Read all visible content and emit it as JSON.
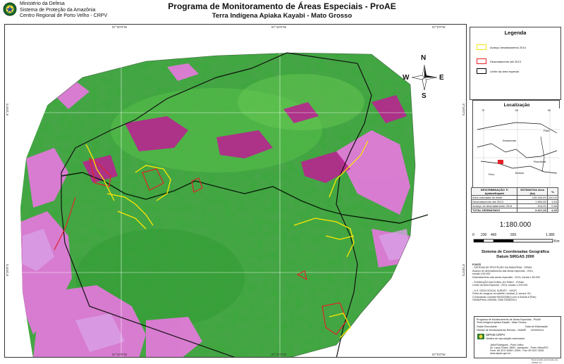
{
  "header": {
    "org_lines": [
      "Ministério da Defesa",
      "Sistema de Proteção da Amazônia",
      "Centro Regional de Porto Velho - CRPV"
    ],
    "title": "Programa de Monitoramento de Áreas Especiais - ProAE",
    "subtitle": "Terra Indígena Apiaka Kayabi - Mato Grosso"
  },
  "map": {
    "grid_labels_top": [
      "57°20'0\"W",
      "57°10'0\"W",
      "57°0'0\"W"
    ],
    "grid_labels_bottom": [
      "57°20'0\"W",
      "57°10'0\"W",
      "57°0'0\"W"
    ],
    "grid_labels_left": [
      "9°10'0\"S",
      "9°20'0\"S"
    ],
    "grid_labels_right": [
      "9°10'0\"S",
      "9°20'0\"S"
    ],
    "compass": {
      "n": "N",
      "s": "S",
      "e": "E",
      "w": "W"
    },
    "colors": {
      "forest": "#3aa83a",
      "forest_dark": "#238a2a",
      "deforested": "#e07ad8",
      "deforested_dark": "#b7268f",
      "advance_2014": "#ffe800",
      "deforested_2013": "#e4222a",
      "boundary": "#000000"
    }
  },
  "legend": {
    "title": "Legenda",
    "items": [
      {
        "label": "Avanço desmatamento 2014",
        "color": "#f2e41a"
      },
      {
        "label": "Desmatamento até 2013",
        "color": "#e4222a"
      },
      {
        "label": "Limite da área especial",
        "color": "#000000"
      }
    ]
  },
  "location": {
    "title": "Localização",
    "ticks_top": [
      "70",
      "60",
      "50"
    ],
    "places": [
      "Amazonas",
      "Pará",
      "Bolivia",
      "Rondônia",
      "Peru"
    ]
  },
  "table": {
    "headers": [
      "DESCRIMINAÇÃO\nTI Apiaka/Kayabi",
      "ESTIMATIVA\nÁrea (ha)",
      "%"
    ],
    "rows": [
      [
        "Área calculada do limite",
        "109.540,69",
        "100,00"
      ],
      [
        "Desmatamento até 2013",
        "1.800,55",
        "1,64"
      ],
      [
        "Avanço do desmatamento 2014",
        "616,00",
        "0,56"
      ]
    ],
    "total": [
      "TOTAL DESMATADO",
      "2.417,15",
      "2,20"
    ]
  },
  "scale": {
    "ratio": "1:180.000",
    "ticks": [
      "0",
      "230",
      "460",
      "920",
      "1.380"
    ],
    "unit": "Km",
    "crs_line1": "Sistema de Coordenadas Geográfica",
    "crs_line2": "Datum SIRGAS 2000"
  },
  "sources": {
    "heading": "FONTE",
    "lines": [
      "- SISTEMA DE PROTEÇÃO DA AMAZÔNIA - SIPAM",
      "  Avanço do desmatamento das áreas especiais - 2014,",
      "  escala 1:50.000",
      "  Desmatamento das áreas especiais - 2013, escala 1:50.000",
      "",
      "- FUNDAÇÃO NACIONAL DO ÍNDIO - FUNAI",
      "  Limite da Área Especial - 2014, escala 1:100.000",
      "",
      "- U.S. GEOLOGICAL SURVEY - USGS",
      "  Folha de imagens do satélite Landsat_8, sensor OLI,",
      "  Composição colorida R(6)G(5)B(4) com a Banda 8 (Pan)",
      "  Órbita/Ponto 228/066, Data 15/08/2014"
    ]
  },
  "info": {
    "line1": "Programa de Monitoramento de Áreas Especiais - ProAE",
    "line2": "Terra Indígena Apiaka Kayabi - Mato Grosso",
    "row_a_left": "Grade Executante",
    "row_a_right": "Data de Elaboração",
    "row_b_left": "Divisão de Monitoramento Remoto - DIAMR",
    "row_b_right": "02/09/2014",
    "org_mark": "SIPAM CRPV",
    "org_sub": "Direitos de reprodução reservados",
    "credit_lines": [
      "Jaimi Rodrigues - Porto Velho",
      "Av. Lauro Sodré, 6500 - Aeroporto - Porto Velho/RO",
      "Fone: 69 3217-6300 / 6399 - Fax: 69 3217-6301",
      "www.sipam.gov.br"
    ]
  },
  "footer": "Reprodução autorizada pelo SIPAM 4.0"
}
